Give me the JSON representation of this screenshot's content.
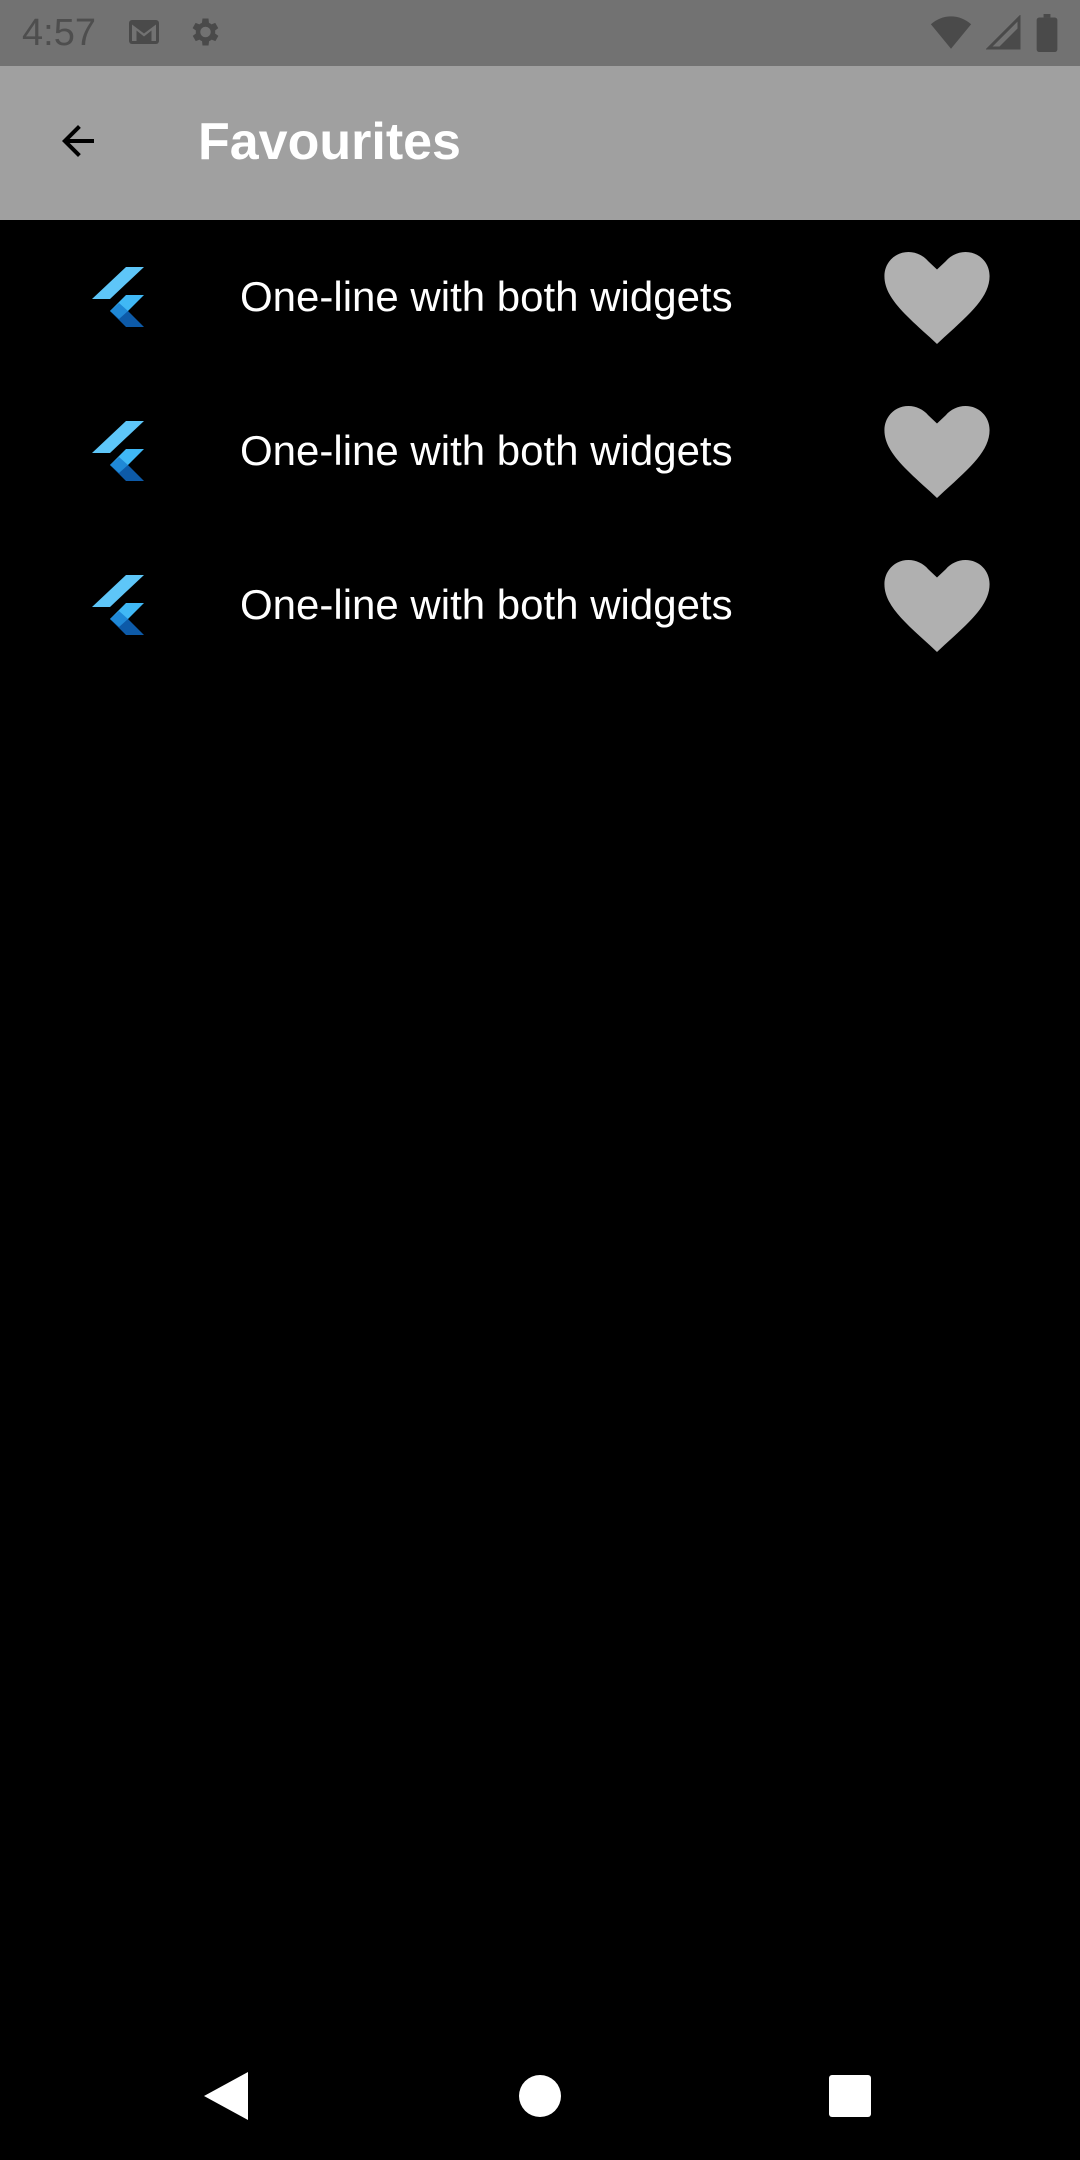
{
  "status_bar": {
    "time": "4:57",
    "left_icons": [
      "gmail-icon",
      "settings-icon"
    ],
    "right_icons": [
      "wifi-icon",
      "signal-icon",
      "battery-icon"
    ],
    "background": "#727272"
  },
  "app_bar": {
    "title": "Favourites",
    "back_icon": "back-arrow-icon",
    "background": "#a0a0a0"
  },
  "list": {
    "items": [
      {
        "title": "One-line with both widgets",
        "leading_icon": "flutter-logo-icon",
        "trailing_icon": "heart-icon"
      },
      {
        "title": "One-line with both widgets",
        "leading_icon": "flutter-logo-icon",
        "trailing_icon": "heart-icon"
      },
      {
        "title": "One-line with both widgets",
        "leading_icon": "flutter-logo-icon",
        "trailing_icon": "heart-icon"
      }
    ],
    "heart_color": "#b0b0b0"
  },
  "nav_bar": {
    "buttons": [
      "nav-back-icon",
      "nav-home-icon",
      "nav-recents-icon"
    ]
  }
}
